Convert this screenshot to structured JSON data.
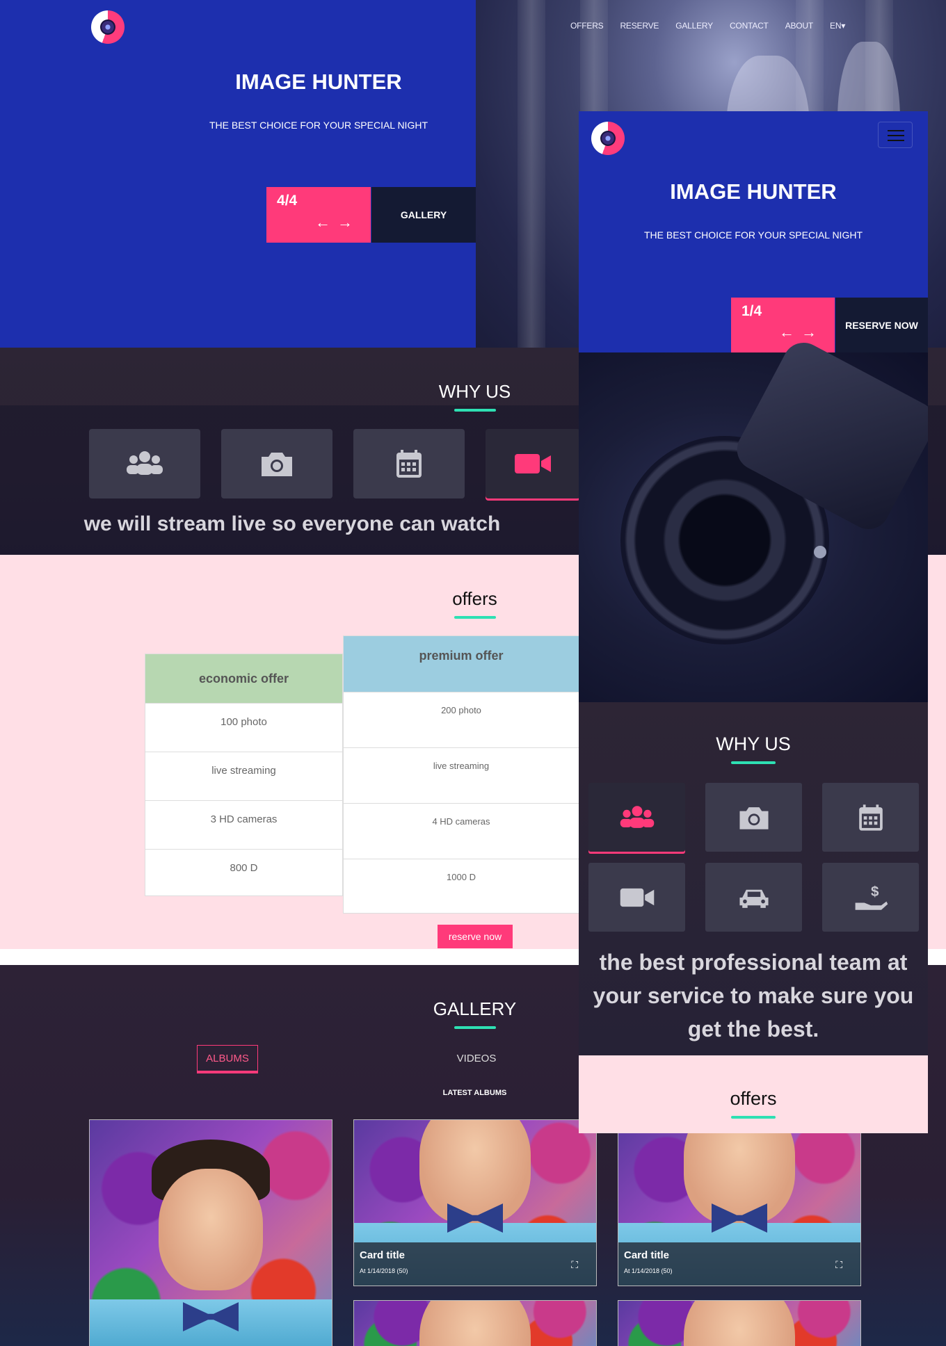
{
  "nav": {
    "items": [
      "OFFERS",
      "RESERVE",
      "GALLERY",
      "CONTACT",
      "ABOUT"
    ],
    "lang": "EN"
  },
  "hero": {
    "title": "IMAGE HUNTER",
    "subtitle": "THE BEST CHOICE FOR YOUR SPECIAL NIGHT",
    "counter": "4/4",
    "button": "GALLERY"
  },
  "why": {
    "title": "WHY US",
    "text": "we will stream live so everyone can watch"
  },
  "offers": {
    "title": "offers",
    "economic": {
      "name": "economic offer",
      "rows": [
        "100 photo",
        "live streaming",
        "3 HD cameras",
        "800 D"
      ]
    },
    "premium": {
      "name": "premium offer",
      "rows": [
        "200 photo",
        "live streaming",
        "4 HD cameras",
        "1000 D"
      ]
    },
    "button": "reserve now"
  },
  "gallery": {
    "title": "GALLERY",
    "tabs": [
      "ALBUMS",
      "VIDEOS"
    ],
    "subtitle": "LATEST ALBUMS",
    "cards": [
      {
        "title": "Card title",
        "date": "At 1/14/2018 (50)"
      },
      {
        "title": "Card title",
        "date": "At 1/14/2018 (50)"
      }
    ]
  },
  "mobile": {
    "hero_title": "IMAGE HUNTER",
    "hero_subtitle": "THE BEST CHOICE FOR YOUR SPECIAL NIGHT",
    "counter": "1/4",
    "button": "RESERVE NOW",
    "why_title": "WHY US",
    "why_text": "the best professional team at your service to make sure you get the best.",
    "offers_title": "offers"
  },
  "colors": {
    "brand_blue": "#1d2fae",
    "accent_pink": "#ff3a7a",
    "underline_teal": "#2ee0b3",
    "offers_bg": "#ffdfe6"
  },
  "icons": [
    "team-icon",
    "camera-icon",
    "calendar-icon",
    "video-icon",
    "car-icon",
    "money-hand-icon",
    "menu-icon",
    "arrow-left-icon",
    "arrow-right-icon",
    "expand-icon"
  ]
}
